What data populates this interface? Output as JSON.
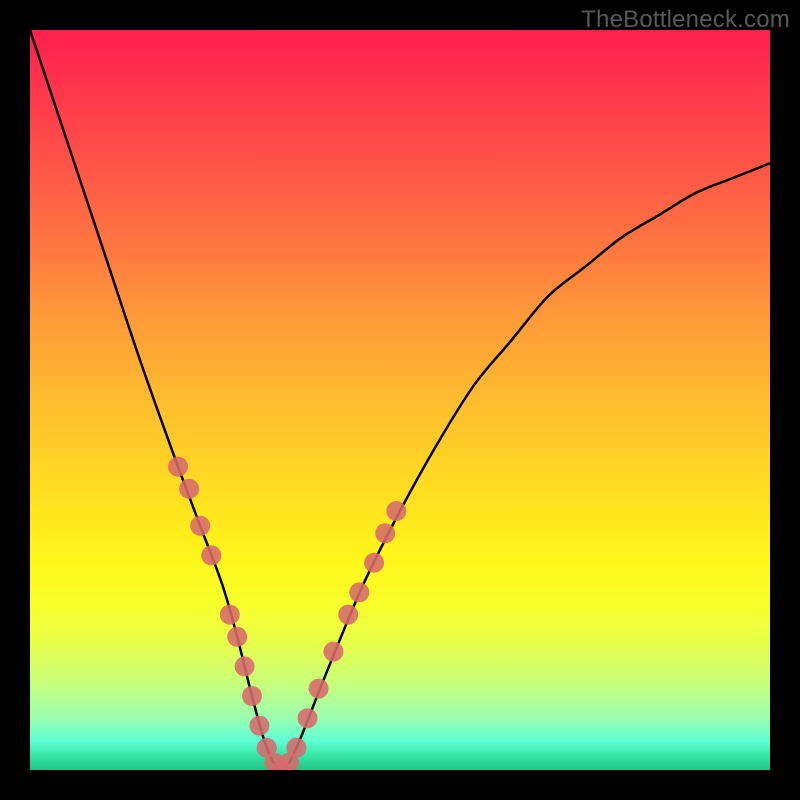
{
  "watermark": "TheBottleneck.com",
  "chart_data": {
    "type": "line",
    "title": "",
    "xlabel": "",
    "ylabel": "",
    "xlim": [
      0,
      100
    ],
    "ylim": [
      0,
      100
    ],
    "grid": false,
    "legend": false,
    "series": [
      {
        "name": "curve",
        "x": [
          0,
          5,
          10,
          15,
          20,
          23,
          26,
          28,
          30,
          32,
          34,
          36,
          40,
          45,
          50,
          55,
          60,
          65,
          70,
          75,
          80,
          85,
          90,
          95,
          100
        ],
        "y": [
          100,
          85,
          70,
          55,
          41,
          33,
          25,
          18,
          10,
          3,
          0,
          3,
          13,
          25,
          35,
          44,
          52,
          58,
          64,
          68,
          72,
          75,
          78,
          80,
          82
        ]
      }
    ],
    "markers": {
      "name": "beads",
      "color": "#d76a6c",
      "radius": 10,
      "points": [
        {
          "x": 20,
          "y": 41
        },
        {
          "x": 21.5,
          "y": 38
        },
        {
          "x": 23,
          "y": 33
        },
        {
          "x": 24.5,
          "y": 29
        },
        {
          "x": 27,
          "y": 21
        },
        {
          "x": 28,
          "y": 18
        },
        {
          "x": 29,
          "y": 14
        },
        {
          "x": 30,
          "y": 10
        },
        {
          "x": 31,
          "y": 6
        },
        {
          "x": 32,
          "y": 3
        },
        {
          "x": 33,
          "y": 1
        },
        {
          "x": 34,
          "y": 0
        },
        {
          "x": 35,
          "y": 1
        },
        {
          "x": 36,
          "y": 3
        },
        {
          "x": 37.5,
          "y": 7
        },
        {
          "x": 39,
          "y": 11
        },
        {
          "x": 41,
          "y": 16
        },
        {
          "x": 43,
          "y": 21
        },
        {
          "x": 44.5,
          "y": 24
        },
        {
          "x": 46.5,
          "y": 28
        },
        {
          "x": 48,
          "y": 32
        },
        {
          "x": 49.5,
          "y": 35
        }
      ]
    },
    "background_gradient": {
      "top": "#ff1f4e",
      "mid": "#ffd226",
      "bottom": "#1fc689"
    }
  }
}
